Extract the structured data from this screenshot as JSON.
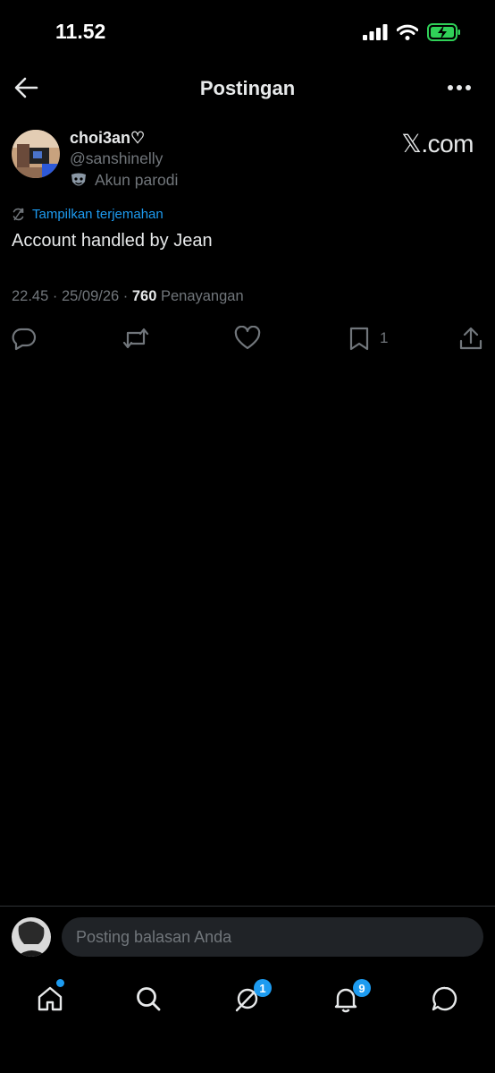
{
  "status_bar": {
    "time": "11.52",
    "battery_color": "#30d158"
  },
  "header": {
    "title": "Postingan"
  },
  "post": {
    "author_name": "choi3an♡",
    "handle": "@sanshinelly",
    "parody_label": "Akun parodi",
    "brand": "𝕏.com",
    "translate_label": "Tampilkan terjemahan",
    "text": "Account handled by Jean",
    "time": "22.45 · 25/09/26 · ",
    "views_count": "760",
    "views_label": " Penayangan",
    "bookmark_count": "1",
    "icons": [
      "reply-icon",
      "repost-icon",
      "like-icon",
      "bookmark-icon",
      "share-icon"
    ]
  },
  "reply": {
    "placeholder": "Posting balasan Anda"
  },
  "tabbar": {
    "grok_badge": "1",
    "notifications_badge": "9",
    "accent": "#1d9bf0"
  }
}
